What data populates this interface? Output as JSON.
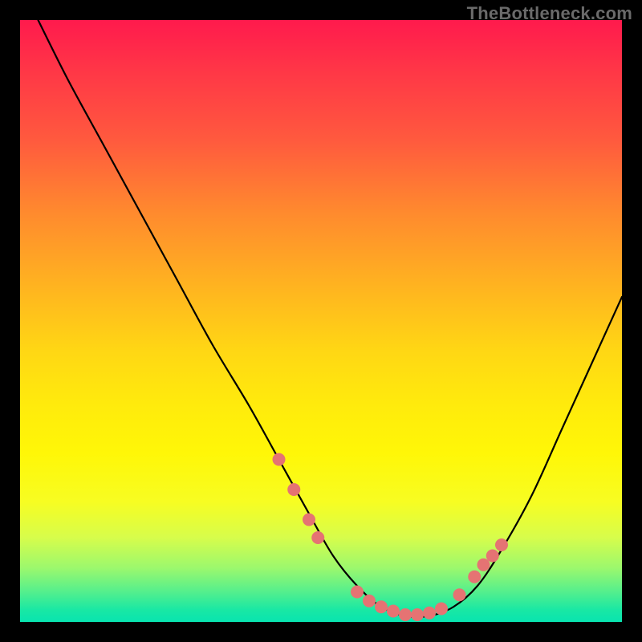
{
  "watermark": {
    "text": "TheBottleneck.com"
  },
  "chart_data": {
    "type": "line",
    "title": "",
    "xlabel": "",
    "ylabel": "",
    "xlim": [
      0,
      100
    ],
    "ylim": [
      0,
      100
    ],
    "grid": false,
    "legend": false,
    "background": "vertical-gradient red→yellow→green",
    "series": [
      {
        "name": "curve",
        "color": "#000000",
        "x": [
          3,
          8,
          14,
          20,
          26,
          32,
          38,
          43,
          48,
          52,
          56,
          60,
          64,
          68,
          72,
          76,
          80,
          85,
          90,
          95,
          100
        ],
        "y": [
          100,
          90,
          79,
          68,
          57,
          46,
          36,
          27,
          18,
          11,
          6,
          2.5,
          1,
          1,
          2.5,
          6,
          12,
          21,
          32,
          43,
          54
        ]
      }
    ],
    "markers": {
      "name": "highlight-dots",
      "color": "#e57373",
      "radius_px": 8,
      "x": [
        43,
        45.5,
        48,
        49.5,
        56,
        58,
        60,
        62,
        64,
        66,
        68,
        70,
        73,
        75.5,
        77,
        78.5,
        80
      ],
      "y": [
        27,
        22,
        17,
        14,
        5,
        3.5,
        2.5,
        1.8,
        1.2,
        1.2,
        1.5,
        2.2,
        4.5,
        7.5,
        9.5,
        11,
        12.8
      ]
    }
  }
}
